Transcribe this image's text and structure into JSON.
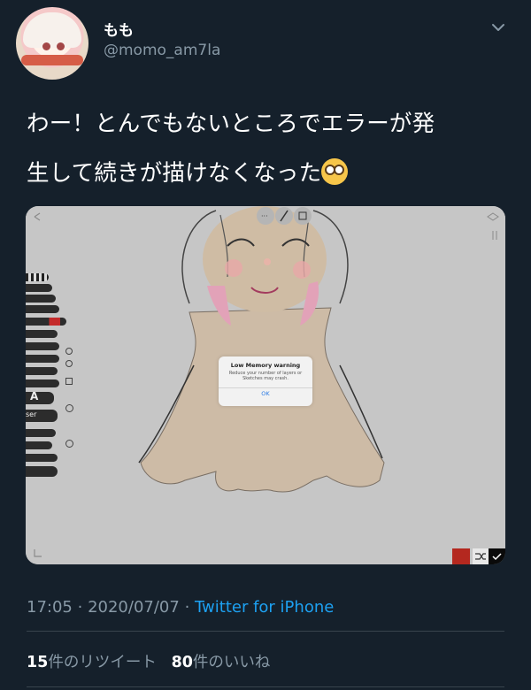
{
  "tweet": {
    "display_name": "もも",
    "handle": "@momo_am7la",
    "text_line1": "わー！とんでもないところでエラーが発",
    "text_line2": "生して続きが描けなくなった",
    "emoji_icon": "flushed-face-emoji",
    "time": "17:05",
    "date": "2020/07/07",
    "separator": "·",
    "source": "Twitter for iPhone",
    "retweet_count": "15",
    "retweet_label": "件のリツイート",
    "like_count": "80",
    "like_label": "件のいいね"
  },
  "media": {
    "tool_label": "A",
    "tool_label_2": "ser",
    "dialog": {
      "title": "Low Memory warning",
      "message": "Reduce your number of layers or Sketches may crash.",
      "ok_label": "OK"
    },
    "active_color": "#b4281f"
  },
  "colors": {
    "background": "#15202b",
    "secondary_text": "#8899a6",
    "link": "#1da1f2",
    "divider": "#38444d"
  }
}
